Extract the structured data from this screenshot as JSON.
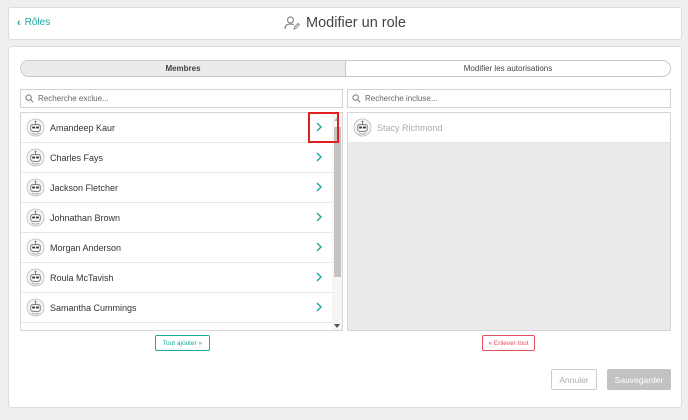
{
  "header": {
    "back_label": "Rôles",
    "title": "Modifier un role"
  },
  "tabs": [
    {
      "label": "Membres",
      "active": true
    },
    {
      "label": "Modifier les autorisations",
      "active": false
    }
  ],
  "left_panel": {
    "search_placeholder": "Recherche exclue...",
    "members": [
      "Amandeep Kaur",
      "Charles Fays",
      "Jackson Fletcher",
      "Johnathan Brown",
      "Morgan Anderson",
      "Roula McTavish",
      "Samantha Cummings"
    ],
    "add_all_label": "Tout ajouter »"
  },
  "right_panel": {
    "search_placeholder": "Recherche incluse...",
    "members": [
      "Stacy Richmond"
    ],
    "remove_all_label": "« Enlever tout"
  },
  "footer": {
    "cancel_label": "Annuler",
    "save_label": "Sauvegarder"
  },
  "colors": {
    "accent": "#1aa9a0",
    "danger": "#e2505b",
    "highlight": "#e02020"
  }
}
